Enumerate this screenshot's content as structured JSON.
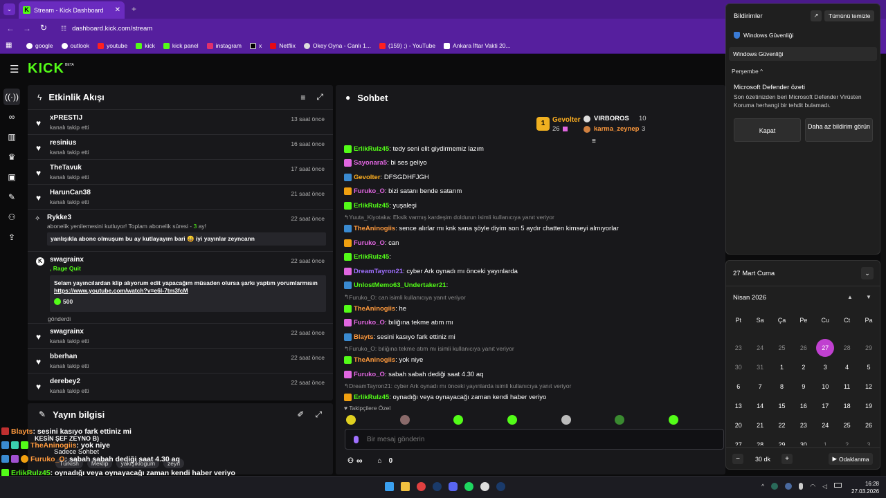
{
  "browser": {
    "tab_title": "Stream - Kick Dashboard",
    "url": "dashboard.kick.com/stream",
    "bookmarks": [
      "google",
      "outlook",
      "youtube",
      "kick",
      "kick panel",
      "instagram",
      "x",
      "Netflix",
      "Okey Oyna - Canlı 1...",
      "(159) ;) - YouTube",
      "Ankara İftar Vakti 20..."
    ]
  },
  "kick": {
    "logo": "KICK",
    "beta": "BETA"
  },
  "activity": {
    "title": "Etkinlik Akışı",
    "items": [
      {
        "name": "xPRESTIJ",
        "sub": "kanalı takip etti",
        "time": "13 saat önce"
      },
      {
        "name": "resinius",
        "sub": "kanalı takip etti",
        "time": "16 saat önce"
      },
      {
        "name": "TheTavuk",
        "sub": "kanalı takip etti",
        "time": "17 saat önce"
      },
      {
        "name": "HarunCan38",
        "sub": "kanalı takip etti",
        "time": "21 saat önce"
      }
    ],
    "sub_event": {
      "name": "Rykke3",
      "time": "22 saat önce",
      "text": "abonelik yenilemesini kutluyor! Toplam abonelik süresi -",
      "months": "3",
      "suffix": "ay!",
      "message": "yanlışıkla abone olmuşum bu ay kutlayayım bari 😄 iyi yayınlar zeyncann"
    },
    "rage_event": {
      "name": "swagrainx",
      "tag": ", Rage Quit",
      "time": "22 saat önce",
      "message": "Selam yayıncılardan klip alıyorum edit yapacağım müsaden olursa şarkı yaptım yorumlarmısın",
      "link": "https://www.youtube.com/watch?v=e6l-7tm3fcM",
      "amount": "500",
      "sent": "gönderdi"
    },
    "items2": [
      {
        "name": "swagrainx",
        "sub": "kanalı takip etti",
        "time": "22 saat önce"
      },
      {
        "name": "bberhan",
        "sub": "kanalı takip etti",
        "time": "22 saat önce"
      },
      {
        "name": "derebey2",
        "sub": "kanalı takip etti",
        "time": "22 saat önce"
      }
    ]
  },
  "stream_info": {
    "title": "Yayın bilgisi",
    "mode": "Sadece Sohbet",
    "title_line": "KESİN ŞEF ZEYNO B)",
    "tags": [
      "Türkish",
      "Meklip",
      "yakışıklogum",
      "zeyn"
    ]
  },
  "overlay_chat": [
    {
      "user": "Blayts",
      "text": " : sesini kasıyo fark ettiniz mi",
      "color": "#ff9a3d"
    },
    {
      "user": "TheAninogiis",
      "text": " : yok niye",
      "color": "#ff9a3d"
    },
    {
      "user": "Furuko_O",
      "text": " : sabah sabah dediği saat 4.30 aq",
      "color": "#ff9a3d"
    },
    {
      "user": "ErlikRulz45",
      "text": " : oynadığı veya oynayacağı zaman kendi haber veriyo",
      "color": "#53fc18"
    }
  ],
  "chat": {
    "title": "Sohbet",
    "top": [
      {
        "rank": "1",
        "name": "Gevolter",
        "count": "26"
      },
      {
        "name": "VIRBOROS",
        "count": "10"
      },
      {
        "name": "karma_zeynep",
        "count": "3"
      }
    ],
    "messages": [
      {
        "type": "msg",
        "user": "ErlikRulz45",
        "color": "#53fc18",
        "text": ": tedy seni elit giydirmemiz lazım"
      },
      {
        "type": "msg",
        "user": "Sayonara5",
        "color": "#e066e0",
        "text": ": bi ses geliyo"
      },
      {
        "type": "msg",
        "user": "Gevolter",
        "color": "#ffb020",
        "text": ": DFSGDHFJGH"
      },
      {
        "type": "msg",
        "user": "Furuko_O",
        "color": "#e066e0",
        "text": ": bizi satanı bende satarım"
      },
      {
        "type": "msg",
        "user": "ErlikRulz45",
        "color": "#53fc18",
        "text": ": yuşaleşi"
      },
      {
        "type": "reply",
        "text": "Yuuta_Kiyotaka: Eksik varmış kardeşim doldurun isimli kullanıcıya yanıt veriyor"
      },
      {
        "type": "msg",
        "user": "TheAninogiis",
        "color": "#ff9a3d",
        "text": ": sence alırlar mı knk sana şöyle diyim son 5 aydır chatten kimseyi almıyorlar"
      },
      {
        "type": "msg",
        "user": "Furuko_O",
        "color": "#e066e0",
        "text": ": can"
      },
      {
        "type": "msg",
        "user": "ErlikRulz45",
        "color": "#53fc18",
        "text": ":"
      },
      {
        "type": "msg",
        "user": "DreamTayron21",
        "color": "#a070ff",
        "text": ": cyber Ark oynadı mı önceki yayınlarda"
      },
      {
        "type": "msg",
        "user": "UnlostMemo63_Undertaker21",
        "color": "#53fc18",
        "text": ":"
      },
      {
        "type": "reply",
        "text": "Furuko_O: can isimli kullanıcıya yanıt veriyor"
      },
      {
        "type": "msg",
        "user": "TheAninogiis",
        "color": "#ff9a3d",
        "text": ": he"
      },
      {
        "type": "msg",
        "user": "Furuko_O",
        "color": "#e066e0",
        "text": ": bıliğına tekme atım mı"
      },
      {
        "type": "msg",
        "user": "Blayts",
        "color": "#ff9a3d",
        "text": ": sesini kasıyo fark ettiniz mi"
      },
      {
        "type": "reply",
        "text": "Furuko_O: bıliğına tekme atım mı isimli kullanıcıya yanıt veriyor"
      },
      {
        "type": "msg",
        "user": "TheAninogiis",
        "color": "#ff9a3d",
        "text": ": yok niye"
      },
      {
        "type": "msg",
        "user": "Furuko_O",
        "color": "#e066e0",
        "text": ": sabah sabah dediği saat 4.30 aq"
      },
      {
        "type": "reply",
        "text": "DreamTayron21: cyber Ark oynadı mı önceki yayınlarda isimli kullanıcıya yanıt veriyor"
      },
      {
        "type": "msg",
        "user": "ErlikRulz45",
        "color": "#53fc18",
        "text": ": oynadığı veya oynayacağı zaman kendi haber veriyo"
      }
    ],
    "followers_only": "Takipçilere Özel",
    "input_placeholder": "Bir mesaj gönderin",
    "infinite": "∞",
    "count": "0"
  },
  "notifications": {
    "title": "Bildirimler",
    "clear_all": "Tümünü temizle",
    "group": "Windows Güvenliği",
    "group2": "Windows Güvenliği",
    "day": "Perşembe",
    "card_title": "Microsoft Defender özeti",
    "card_text": "Son özetinizden beri Microsoft Defender Virüsten Koruma herhangi bir tehdit bulamadı.",
    "btn_close": "Kapat",
    "btn_less": "Daha az bildirim görün"
  },
  "calendar": {
    "date_label": "27 Mart Cuma",
    "month": "Nisan 2026",
    "weekdays": [
      "Pt",
      "Sa",
      "Ça",
      "Pe",
      "Cu",
      "Ct",
      "Pa"
    ],
    "days": [
      "23",
      "24",
      "25",
      "26",
      "27",
      "28",
      "29",
      "30",
      "31",
      "1",
      "2",
      "3",
      "4",
      "5",
      "6",
      "7",
      "8",
      "9",
      "10",
      "11",
      "12",
      "13",
      "14",
      "15",
      "16",
      "17",
      "18",
      "19",
      "20",
      "21",
      "22",
      "23",
      "24",
      "25",
      "26",
      "27",
      "28",
      "29",
      "30",
      "1",
      "2",
      "3"
    ],
    "today_index": 4,
    "focus_minutes": "30 dk",
    "focus_label": "Odaklanma"
  },
  "taskbar": {
    "time": "16:28",
    "date": "27.03.2026"
  }
}
